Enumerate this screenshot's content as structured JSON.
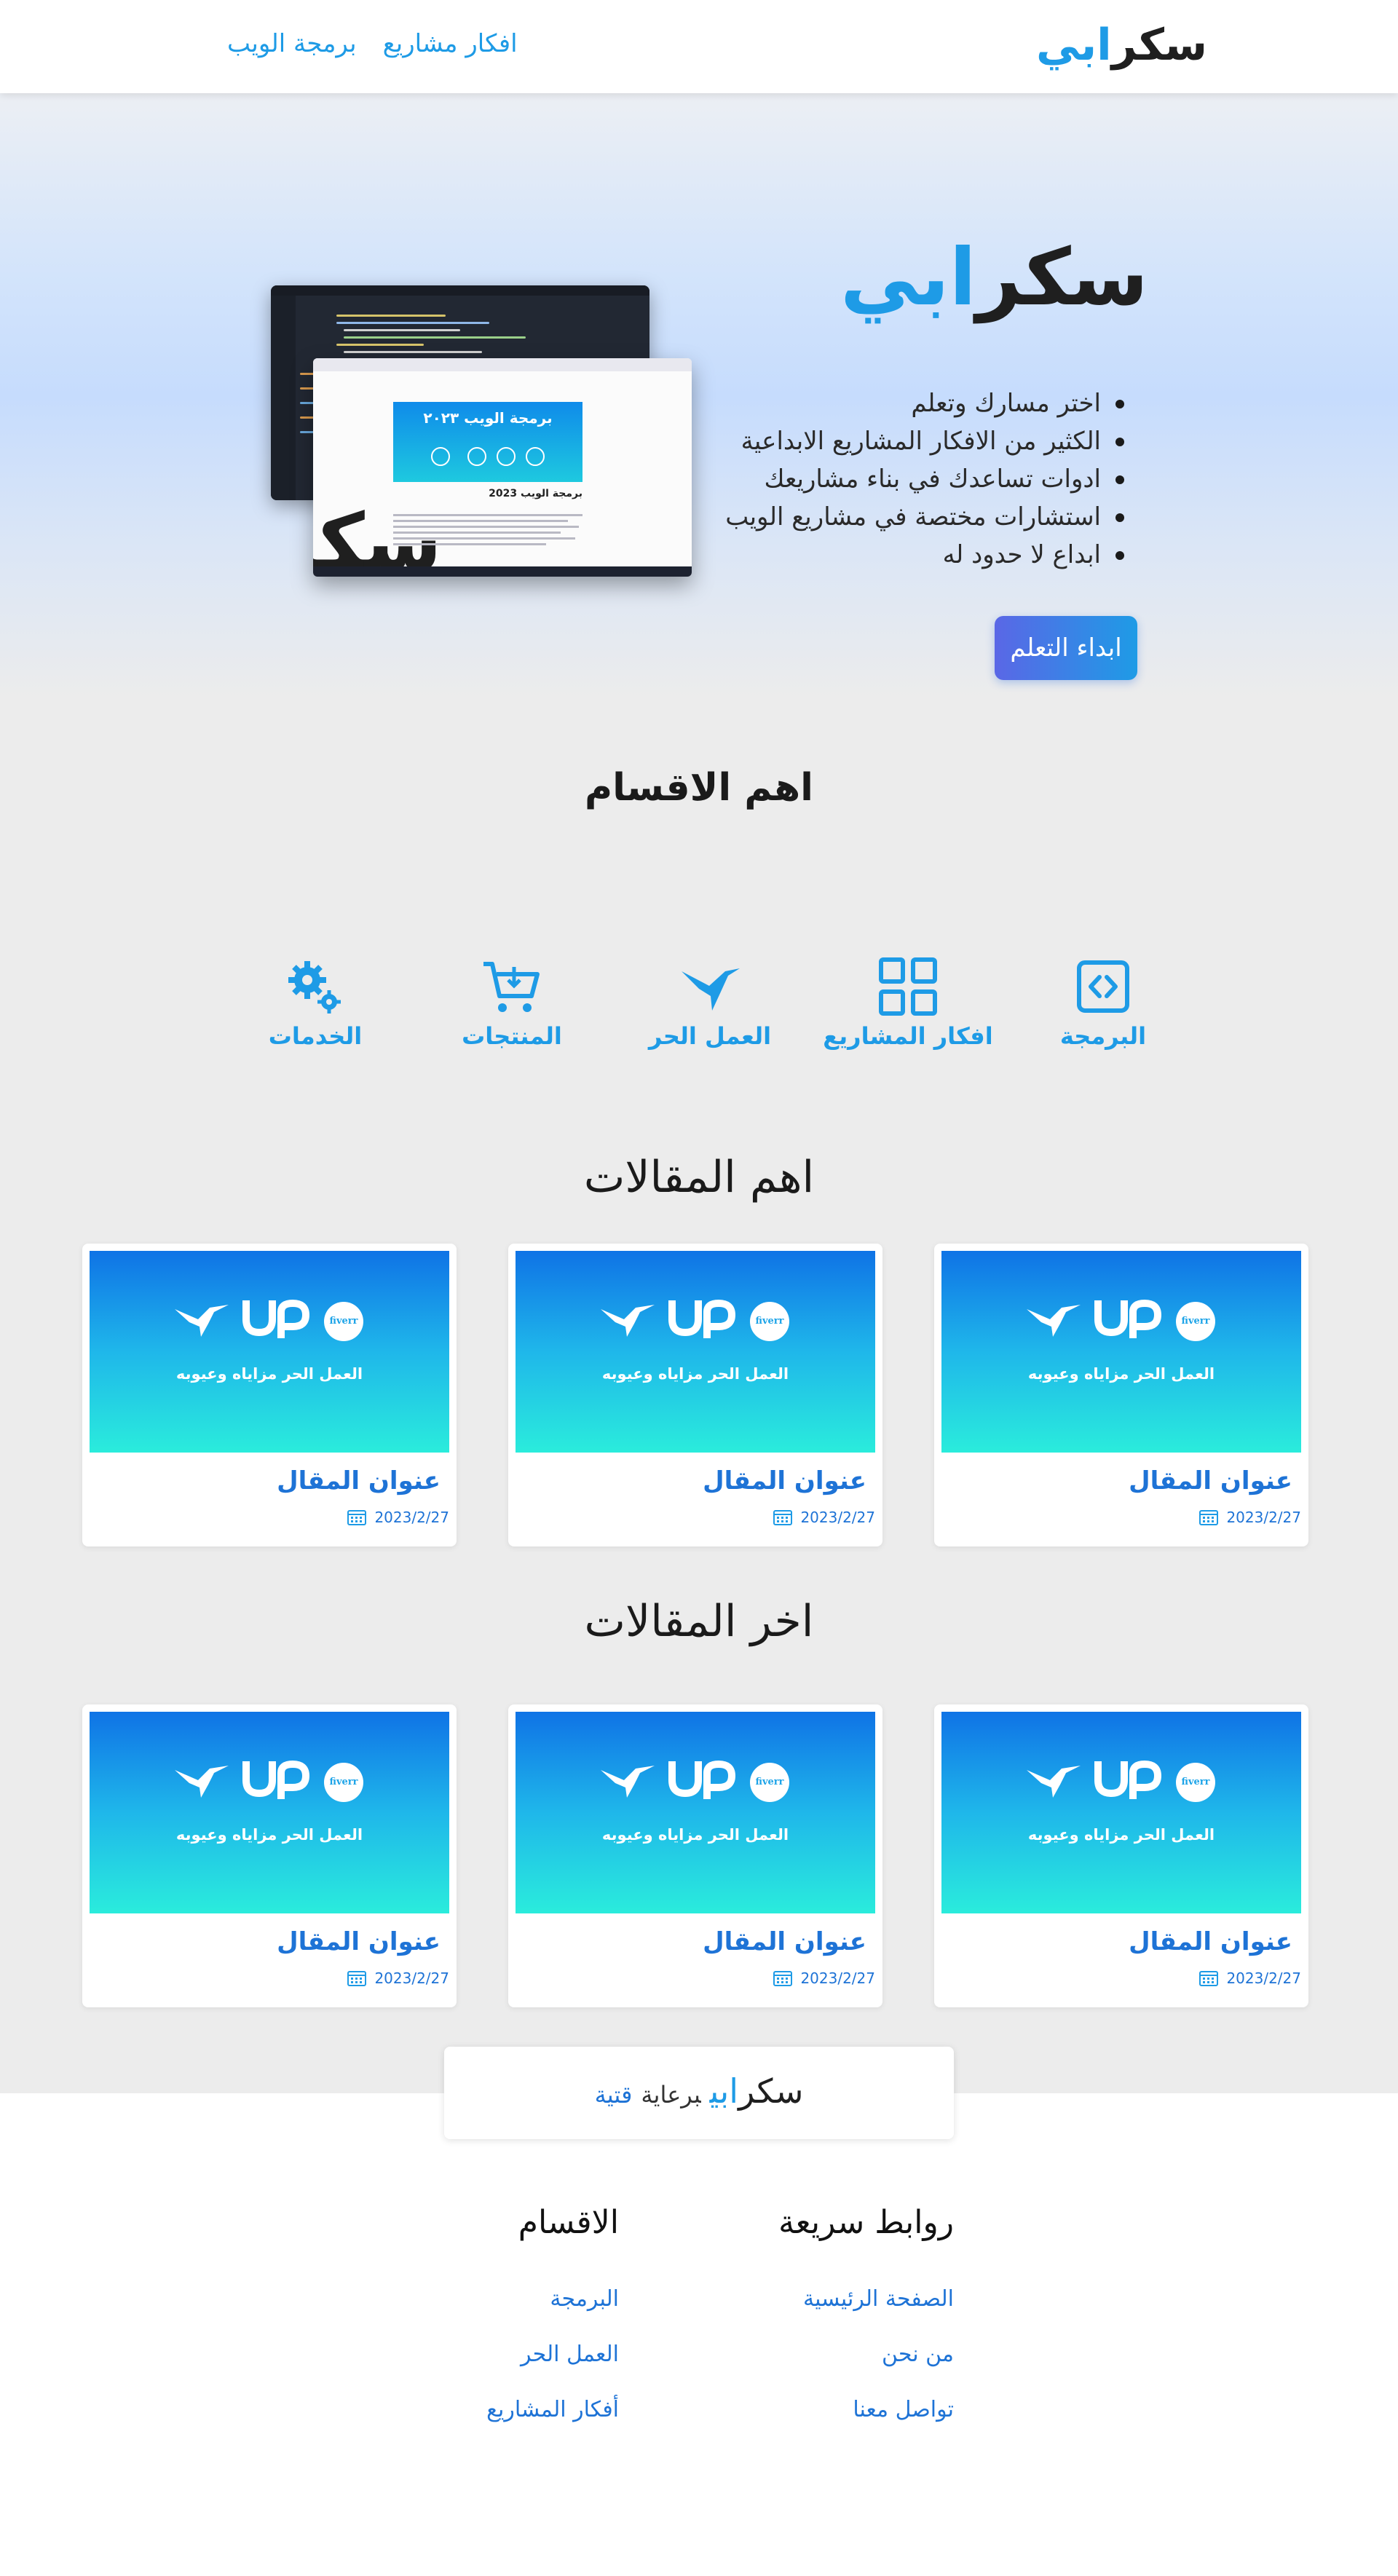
{
  "brand": {
    "part1": "سكر",
    "part2": "ابي"
  },
  "nav": {
    "items": [
      "برمجة الويب",
      "افكار مشاريع"
    ]
  },
  "hero": {
    "features": [
      "اختر مسارك وتعلم",
      "الكثير من الافكار المشاريع الابداعية",
      "ادوات تساعدك في بناء مشاريعك",
      "استشارات مختصة في مشاريع الويب",
      "ابداع لا حدود له"
    ],
    "cta_label": "ابداء التعلم",
    "mockup": {
      "banner_title": "برمجة الويب ٢٠٢٣",
      "post_title": "برمجة الويب 2023"
    }
  },
  "categories": {
    "title": "اهم الاقسام",
    "items": [
      {
        "label": "البرمجة",
        "icon": "code-icon"
      },
      {
        "label": "افكار المشاريع",
        "icon": "grid-icon"
      },
      {
        "label": "العمل الحر",
        "icon": "hummingbird-icon"
      },
      {
        "label": "المنتجات",
        "icon": "cart-icon"
      },
      {
        "label": "الخدمات",
        "icon": "gears-icon"
      }
    ]
  },
  "top_articles": {
    "title": "اهم المقالات",
    "items": [
      {
        "image_text": "العمل الحر مزاياه وعيوبه",
        "title": "عنوان المقال",
        "date": "2023/2/27"
      },
      {
        "image_text": "العمل الحر مزاياه وعيوبه",
        "title": "عنوان المقال",
        "date": "2023/2/27"
      },
      {
        "image_text": "العمل الحر مزاياه وعيوبه",
        "title": "عنوان المقال",
        "date": "2023/2/27"
      }
    ]
  },
  "latest_articles": {
    "title": "اخر المقالات",
    "items": [
      {
        "image_text": "العمل الحر مزاياه وعيوبه",
        "title": "عنوان المقال",
        "date": "2023/2/27"
      },
      {
        "image_text": "العمل الحر مزاياه وعيوبه",
        "title": "عنوان المقال",
        "date": "2023/2/27"
      },
      {
        "image_text": "العمل الحر مزاياه وعيوبه",
        "title": "عنوان المقال",
        "date": "2023/2/27"
      }
    ]
  },
  "card_logos": {
    "upwork": "Up",
    "fiverr": "fiverr"
  },
  "sponsor": {
    "by": "برعاية",
    "sponsor_name": "قتية"
  },
  "footer": {
    "quick_links": {
      "title": "روابط سريعة",
      "links": [
        "الصفحة الرئيسية",
        "من نحن",
        "تواصل معنا"
      ]
    },
    "sections": {
      "title": "الاقسام",
      "links": [
        "البرمجة",
        "العمل الحر",
        "أفكار المشاريع"
      ]
    }
  },
  "colors": {
    "accent": "#1e9be6",
    "link": "#1e73d6",
    "card_gradient_top": "#0f73e6",
    "card_gradient_bottom": "#2aecdc",
    "page_bg": "#ececec"
  }
}
